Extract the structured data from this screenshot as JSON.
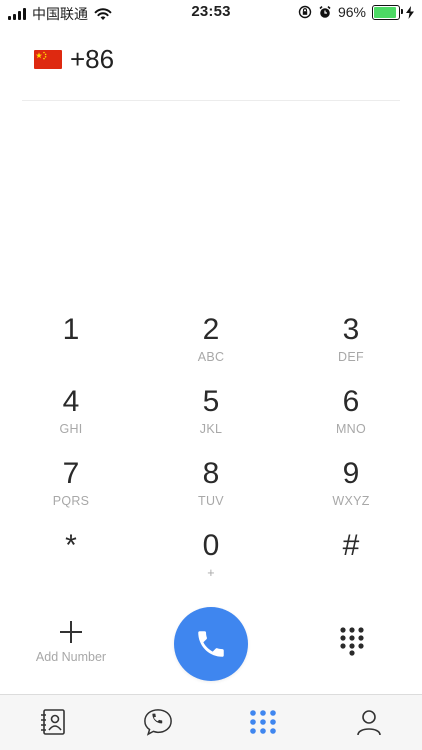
{
  "status_bar": {
    "carrier": "中国联通",
    "time": "23:53",
    "battery_percent": "96%"
  },
  "country": {
    "flag": "china-flag-icon",
    "code": "+86"
  },
  "keypad": {
    "keys": [
      {
        "digit": "1",
        "letters": ""
      },
      {
        "digit": "2",
        "letters": "ABC"
      },
      {
        "digit": "3",
        "letters": "DEF"
      },
      {
        "digit": "4",
        "letters": "GHI"
      },
      {
        "digit": "5",
        "letters": "JKL"
      },
      {
        "digit": "6",
        "letters": "MNO"
      },
      {
        "digit": "7",
        "letters": "PQRS"
      },
      {
        "digit": "8",
        "letters": "TUV"
      },
      {
        "digit": "9",
        "letters": "WXYZ"
      },
      {
        "digit": "*",
        "letters": ""
      },
      {
        "digit": "0",
        "letters": "+"
      },
      {
        "digit": "#",
        "letters": ""
      }
    ]
  },
  "actions": {
    "add_number_label": "Add Number",
    "call_icon": "phone-icon",
    "keypad_toggle_icon": "keypad-dots-icon"
  },
  "tabs": [
    {
      "icon": "contacts-icon",
      "active": false
    },
    {
      "icon": "phone-bubble-icon",
      "active": false
    },
    {
      "icon": "keypad-icon",
      "active": true
    },
    {
      "icon": "profile-icon",
      "active": false
    }
  ],
  "colors": {
    "accent": "#3f86ef",
    "battery": "#4cd964",
    "secondary_text": "#a8a8a8"
  }
}
